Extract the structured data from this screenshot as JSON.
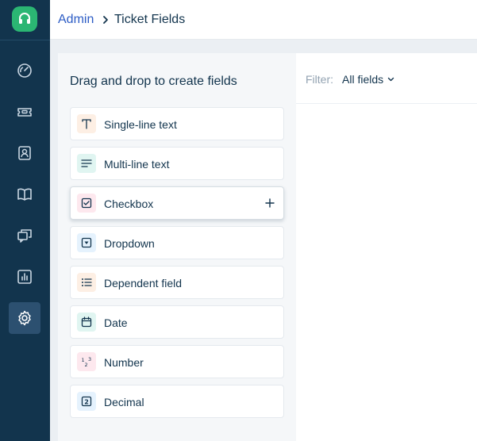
{
  "breadcrumb": {
    "parent": "Admin",
    "current": "Ticket Fields"
  },
  "palette": {
    "title": "Drag and drop to create fields",
    "fields": [
      {
        "label": "Single-line text",
        "icon": "text-t-icon",
        "icon_bg": "#fdefe4",
        "icon_color": "#12344d"
      },
      {
        "label": "Multi-line text",
        "icon": "paragraph-lines-icon",
        "icon_bg": "#e0f5f1",
        "icon_color": "#12344d"
      },
      {
        "label": "Checkbox",
        "icon": "checkbox-icon",
        "icon_bg": "#fde8ee",
        "icon_color": "#12344d"
      },
      {
        "label": "Dropdown",
        "icon": "dropdown-icon",
        "icon_bg": "#e5f2fd",
        "icon_color": "#12344d"
      },
      {
        "label": "Dependent field",
        "icon": "bullet-list-icon",
        "icon_bg": "#fdefe4",
        "icon_color": "#12344d"
      },
      {
        "label": "Date",
        "icon": "calendar-icon",
        "icon_bg": "#e0f5f1",
        "icon_color": "#12344d"
      },
      {
        "label": "Number",
        "icon": "number-icon",
        "icon_bg": "#fde8ee",
        "icon_color": "#12344d"
      },
      {
        "label": "Decimal",
        "icon": "decimal-icon",
        "icon_bg": "#e5f2fd",
        "icon_color": "#12344d"
      }
    ]
  },
  "filter": {
    "label": "Filter:",
    "value": "All fields"
  },
  "nav": [
    "dashboard-icon",
    "tickets-icon",
    "contacts-icon",
    "solutions-icon",
    "discussions-icon",
    "reports-icon",
    "admin-settings-icon"
  ],
  "colors": {
    "sidebar": "#12344d",
    "brand": "#2bb673",
    "link": "#2c5cc5"
  }
}
